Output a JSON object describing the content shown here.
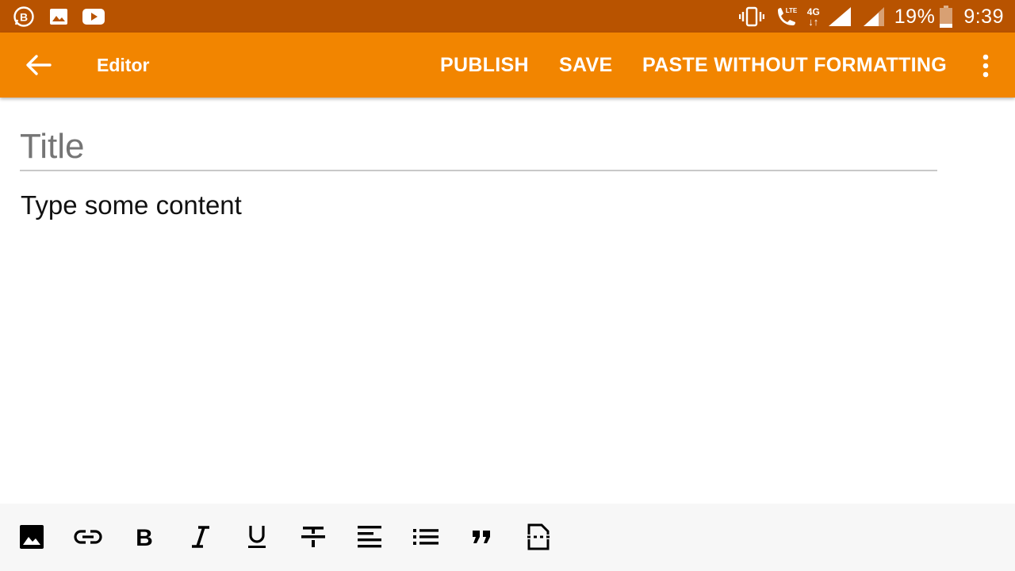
{
  "status_bar": {
    "left_icons": [
      "business-messenger-icon",
      "image-notification-icon",
      "youtube-notification-icon"
    ],
    "right_icons": [
      "vibrate-icon",
      "lte-call-icon",
      "4g-data-icon",
      "signal-icon",
      "signal-icon"
    ],
    "network_label": "4G",
    "lte_label": "LTE",
    "battery_percent": "19%",
    "battery_level": 0.19,
    "time": "9:39"
  },
  "app_bar": {
    "title": "Editor",
    "actions": [
      "PUBLISH",
      "SAVE",
      "PASTE WITHOUT FORMATTING"
    ],
    "more_icon": "more-vert-icon",
    "back_icon": "arrow-back-icon"
  },
  "editor": {
    "title_placeholder": "Title",
    "title_value": "",
    "content_placeholder": "Type some content"
  },
  "toolbar": {
    "buttons": [
      "insert-image-icon",
      "link-icon",
      "bold-icon",
      "italic-icon",
      "underline-icon",
      "strikethrough-icon",
      "align-left-icon",
      "bulleted-list-icon",
      "quote-icon",
      "page-break-icon"
    ]
  },
  "colors": {
    "status_bar": "#b85300",
    "app_bar": "#f28500",
    "toolbar_bg": "#f7f7f7",
    "accent_text": "#ffffff"
  }
}
